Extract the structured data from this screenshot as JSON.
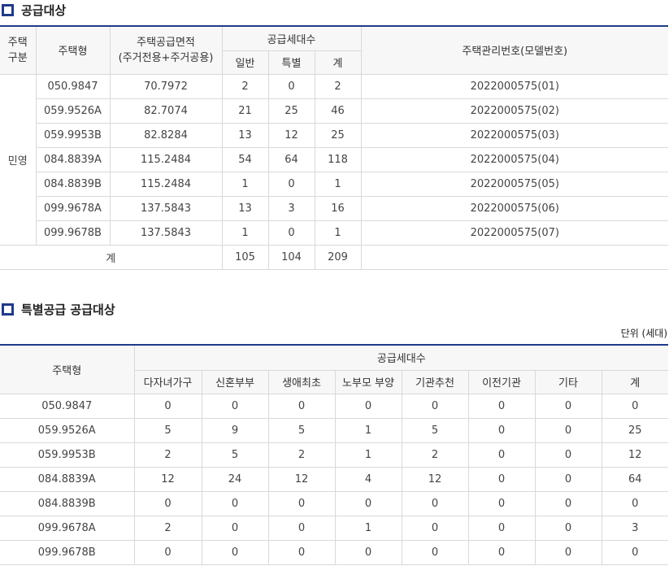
{
  "section1": {
    "title": "공급대상",
    "headers": {
      "house_type_cat_1": "주택",
      "house_type_cat_2": "구분",
      "house_type": "주택형",
      "area_1": "주택공급면적",
      "area_2": "(주거전용+주거공용)",
      "supply_count": "공급세대수",
      "general": "일반",
      "special": "특별",
      "total": "계",
      "model_no": "주택관리번호(모델번호)"
    },
    "category": "민영",
    "rows": [
      {
        "type": "050.9847",
        "area": "70.7972",
        "general": "2",
        "special": "0",
        "total": "2",
        "model": "2022000575(01)"
      },
      {
        "type": "059.9526A",
        "area": "82.7074",
        "general": "21",
        "special": "25",
        "total": "46",
        "model": "2022000575(02)"
      },
      {
        "type": "059.9953B",
        "area": "82.8284",
        "general": "13",
        "special": "12",
        "total": "25",
        "model": "2022000575(03)"
      },
      {
        "type": "084.8839A",
        "area": "115.2484",
        "general": "54",
        "special": "64",
        "total": "118",
        "model": "2022000575(04)"
      },
      {
        "type": "084.8839B",
        "area": "115.2484",
        "general": "1",
        "special": "0",
        "total": "1",
        "model": "2022000575(05)"
      },
      {
        "type": "099.9678A",
        "area": "137.5843",
        "general": "13",
        "special": "3",
        "total": "16",
        "model": "2022000575(06)"
      },
      {
        "type": "099.9678B",
        "area": "137.5843",
        "general": "1",
        "special": "0",
        "total": "1",
        "model": "2022000575(07)"
      }
    ],
    "sum": {
      "label": "계",
      "general": "105",
      "special": "104",
      "total": "209"
    }
  },
  "section2": {
    "title": "특별공급 공급대상",
    "unit": "단위 (세대)",
    "headers": {
      "house_type": "주택형",
      "supply_count": "공급세대수",
      "cols": [
        "다자녀가구",
        "신혼부부",
        "생애최초",
        "노부모 부양",
        "기관추천",
        "이전기관",
        "기타",
        "계"
      ]
    },
    "rows": [
      {
        "type": "050.9847",
        "values": [
          "0",
          "0",
          "0",
          "0",
          "0",
          "0",
          "0",
          "0"
        ]
      },
      {
        "type": "059.9526A",
        "values": [
          "5",
          "9",
          "5",
          "1",
          "5",
          "0",
          "0",
          "25"
        ]
      },
      {
        "type": "059.9953B",
        "values": [
          "2",
          "5",
          "2",
          "1",
          "2",
          "0",
          "0",
          "12"
        ]
      },
      {
        "type": "084.8839A",
        "values": [
          "12",
          "24",
          "12",
          "4",
          "12",
          "0",
          "0",
          "64"
        ]
      },
      {
        "type": "084.8839B",
        "values": [
          "0",
          "0",
          "0",
          "0",
          "0",
          "0",
          "0",
          "0"
        ]
      },
      {
        "type": "099.9678A",
        "values": [
          "2",
          "0",
          "0",
          "1",
          "0",
          "0",
          "0",
          "3"
        ]
      },
      {
        "type": "099.9678B",
        "values": [
          "0",
          "0",
          "0",
          "0",
          "0",
          "0",
          "0",
          "0"
        ]
      }
    ]
  },
  "colors": {
    "accent": "#1f3a8a",
    "border": "#d9d9d9",
    "header_bg": "#f7f7f7"
  }
}
